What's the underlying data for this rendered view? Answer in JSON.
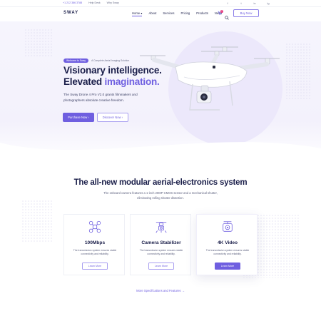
{
  "topbar": {
    "phone": "+1 212 386 3788",
    "links": [
      "Help Desk",
      "Why Sway"
    ],
    "social": [
      "f",
      "t",
      "in",
      "ig"
    ]
  },
  "header": {
    "logo": "SWAY",
    "nav": [
      "Home ▾",
      "About",
      "Services",
      "Pricing",
      "Products",
      "News"
    ],
    "cart_count": "2",
    "buy_now": "Buy Now"
  },
  "hero": {
    "badge": "Welcome to Sway",
    "badge_caption": "A Complete Aerial Imaging Solution",
    "headline_1": "Visionary intelligence.",
    "headline_2_plain": "Elevated ",
    "headline_2_accent": "imagination.",
    "description": "The Sway Drone 4 Pro V2.0 grants filmmakers and photographers absolute creative freedom.",
    "purchase_button": "Purchase Now",
    "discover_button": "Discover Now"
  },
  "section": {
    "title": "The all-new modular aerial-electronics system",
    "subtitle": "The onboard camera features a 1-inch 20MP CMOS sensor and a mechanical shutter, eliminating rolling shutter distortion."
  },
  "cards": [
    {
      "icon": "drone-icon",
      "title": "100Mbps",
      "description": "The transmission system ensures stable connectivity and reliability.",
      "button": "Learn More"
    },
    {
      "icon": "stabilizer-icon",
      "title": "Camera Stabilizer",
      "description": "The transmission system ensures stable connectivity and reliability.",
      "button": "Learn More"
    },
    {
      "icon": "video-camera-icon",
      "title": "4K Video",
      "description": "The transmission system ensures stable connectivity and reliability.",
      "button": "Learn More"
    }
  ],
  "more_link": "More Specifications and Features",
  "colors": {
    "accent": "#6f5fe0",
    "navy": "#1b1f4a",
    "badge": "#e6397d"
  }
}
